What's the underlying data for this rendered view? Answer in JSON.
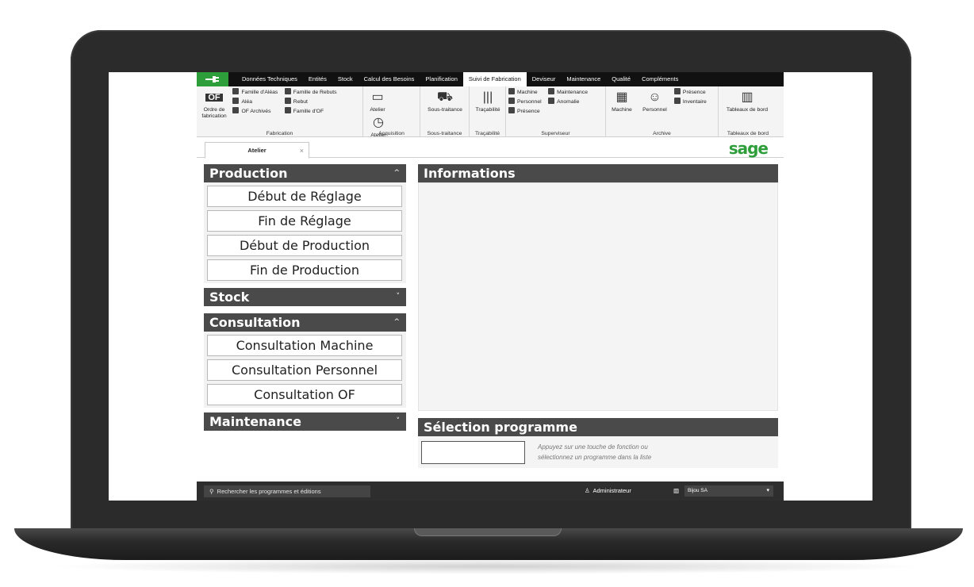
{
  "tabs": [
    {
      "label": "Données Techniques"
    },
    {
      "label": "Entités"
    },
    {
      "label": "Stock"
    },
    {
      "label": "Calcul des Besoins"
    },
    {
      "label": "Planification"
    },
    {
      "label": "Suivi de Fabrication",
      "active": true
    },
    {
      "label": "Deviseur"
    },
    {
      "label": "Maintenance"
    },
    {
      "label": "Qualité"
    },
    {
      "label": "Compléments"
    }
  ],
  "ribbon": {
    "fabrication": {
      "big_label": "Ordre de fabrication",
      "big_icon_text": "OF",
      "items_col1": [
        "Famille d'Aléas",
        "Aléa",
        "OF Archivés"
      ],
      "items_col2": [
        "Famille de Rebuts",
        "Rebut",
        "Famille d'OF"
      ],
      "group_label": "Fabrication"
    },
    "acquisition": {
      "btn1": "Atelier",
      "btn2": "Atelier différé ▾",
      "group_label": "Acquisition"
    },
    "sous_traitance": {
      "btn": "Sous-traitance",
      "group_label": "Sous-traitance"
    },
    "tracabilite": {
      "btn": "Traçabilité",
      "group_label": "Traçabilité"
    },
    "superviseur": {
      "col1": [
        "Machine",
        "Personnel",
        "Présence"
      ],
      "col2": [
        "Maintenance",
        "Anomalie"
      ],
      "group_label": "Superviseur"
    },
    "archive": {
      "btn1": "Machine",
      "btn2": "Personnel",
      "items": [
        "Présence",
        "Inventaire"
      ],
      "group_label": "Archive"
    },
    "tableaux": {
      "btn": "Tableaux de bord",
      "group_label": "Tableaux de bord"
    }
  },
  "doc_tab": {
    "label": "Atelier",
    "close": "×"
  },
  "brand": {
    "logo_text": "sage",
    "color": "#2e9e3a"
  },
  "left": {
    "production": {
      "title": "Production",
      "chevron": "^",
      "buttons": [
        "Début de Réglage",
        "Fin de Réglage",
        "Début de Production",
        "Fin de Production"
      ]
    },
    "stock": {
      "title": "Stock",
      "chevron": "˅"
    },
    "consultation": {
      "title": "Consultation",
      "chevron": "^",
      "buttons": [
        "Consultation Machine",
        "Consultation Personnel",
        "Consultation OF"
      ]
    },
    "maintenance": {
      "title": "Maintenance",
      "chevron": "˅"
    }
  },
  "info": {
    "title": "Informations"
  },
  "selection": {
    "title": "Sélection programme",
    "hint_line1": "Appuyez sur une touche de fonction ou",
    "hint_line2": "sélectionnez un programme dans la liste"
  },
  "status": {
    "search_placeholder": "Rechercher les programmes et éditions",
    "user": "Administrateur",
    "company": "Bijou SA"
  }
}
